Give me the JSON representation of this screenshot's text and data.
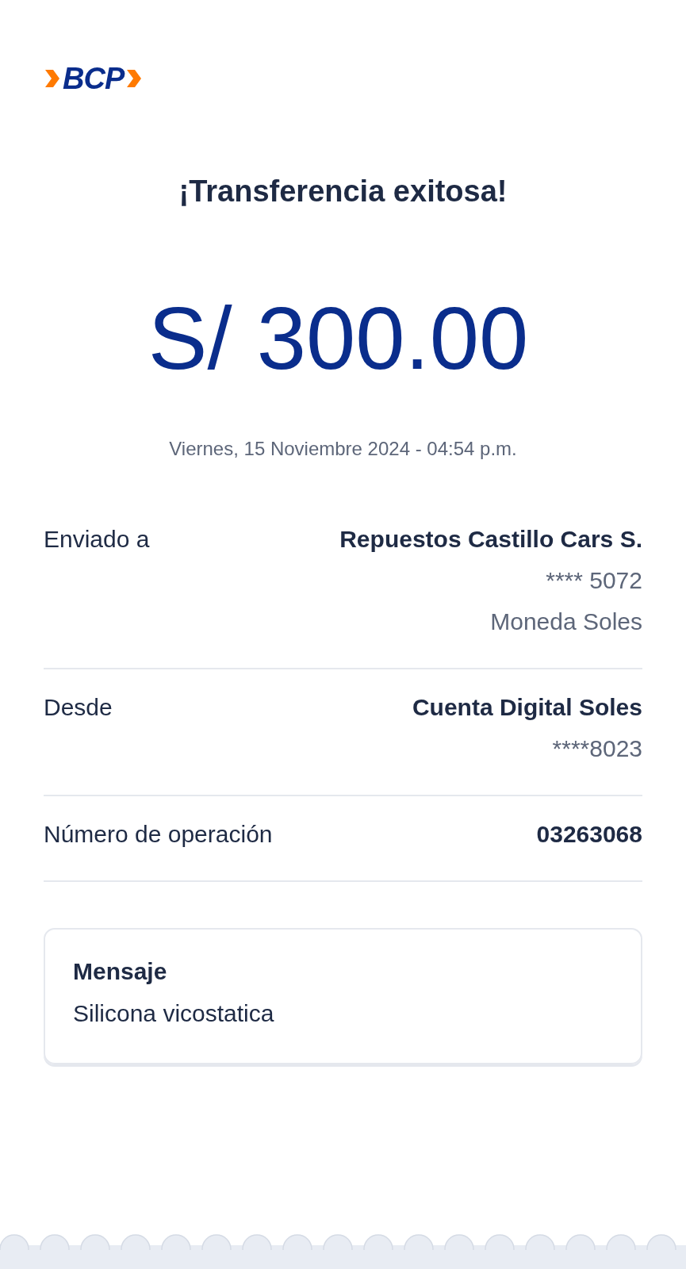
{
  "logo": {
    "text": "BCP"
  },
  "title": "¡Transferencia exitosa!",
  "amount": "S/ 300.00",
  "datetime": "Viernes, 15 Noviembre 2024 - 04:54 p.m.",
  "details": [
    {
      "label": "Enviado a",
      "values": [
        {
          "text": "Repuestos Castillo Cars S.",
          "kind": "primary"
        },
        {
          "text": "**** 5072",
          "kind": "secondary"
        },
        {
          "text": "Moneda Soles",
          "kind": "secondary"
        }
      ]
    },
    {
      "label": "Desde",
      "values": [
        {
          "text": "Cuenta Digital Soles",
          "kind": "primary"
        },
        {
          "text": "****8023",
          "kind": "secondary"
        }
      ]
    },
    {
      "label": "Número de operación",
      "values": [
        {
          "text": "03263068",
          "kind": "primary"
        }
      ]
    }
  ],
  "message": {
    "title": "Mensaje",
    "text": "Silicona vicostatica"
  }
}
